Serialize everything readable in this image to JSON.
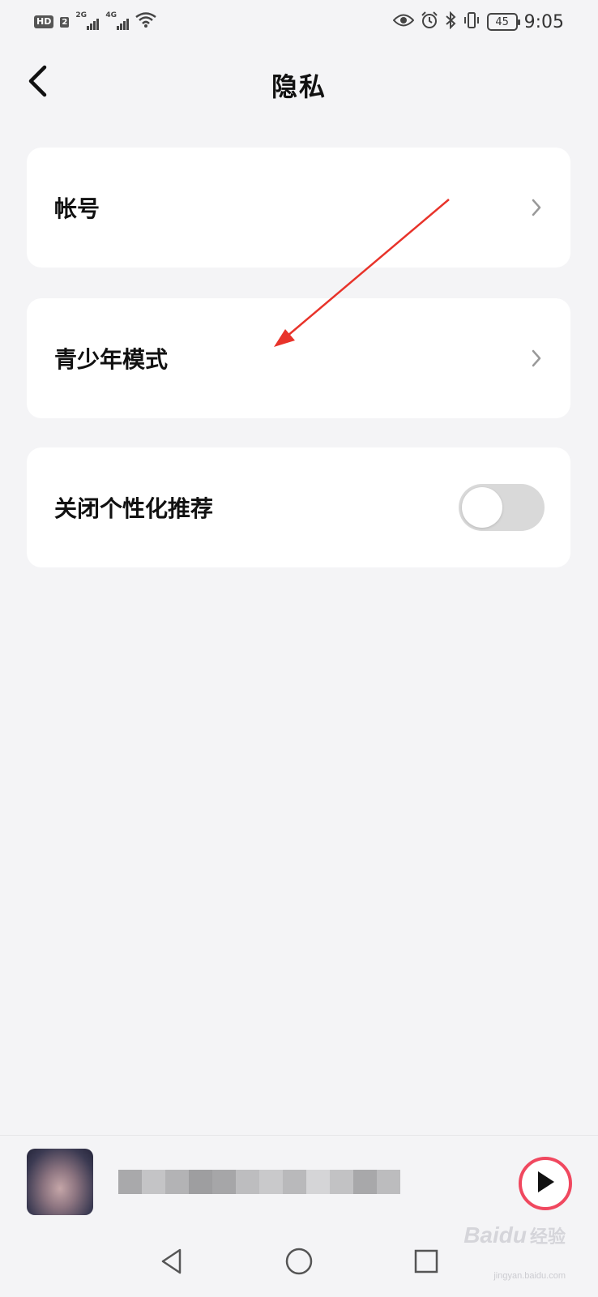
{
  "status_bar": {
    "hd_label": "HD",
    "sim_label": "2",
    "network_1": "2G",
    "network_2": "4G",
    "battery_level": "45",
    "time": "9:05",
    "icons": [
      "eye-icon",
      "alarm-icon",
      "bluetooth-icon",
      "vibrate-icon",
      "wifi-icon"
    ]
  },
  "header": {
    "title": "隐私",
    "back_icon": "chevron-left-icon"
  },
  "settings": {
    "items": [
      {
        "label": "帐号",
        "type": "link"
      },
      {
        "label": "青少年模式",
        "type": "link"
      },
      {
        "label": "关闭个性化推荐",
        "type": "toggle",
        "on": false
      }
    ]
  },
  "player": {
    "song_title": "",
    "play_icon": "play-icon",
    "accent_color": "#f0485f"
  },
  "annotation": {
    "arrow_color": "#e8332a"
  },
  "navbar": {
    "back_icon": "triangle-back-icon",
    "home_icon": "circle-home-icon",
    "recents_icon": "square-recents-icon"
  },
  "watermark": {
    "brand": "Baidu",
    "suffix": "经验",
    "url": "jingyan.baidu.com"
  }
}
